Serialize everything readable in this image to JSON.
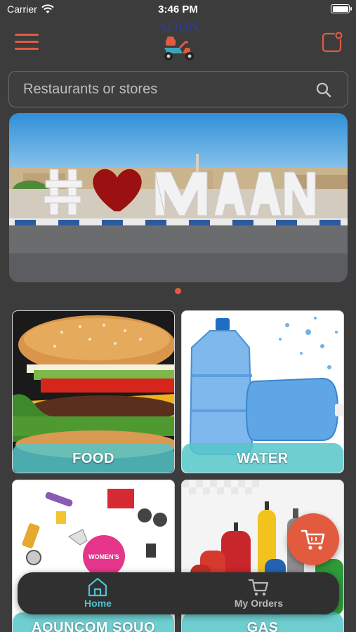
{
  "status_bar": {
    "carrier": "Carrier",
    "time": "3:46 PM"
  },
  "header": {
    "logo_text": "AOUN"
  },
  "search": {
    "placeholder": "Restaurants or stores"
  },
  "banner": {
    "slide_count": 1,
    "active_slide": 0
  },
  "categories": [
    {
      "label": "FOOD"
    },
    {
      "label": "WATER"
    },
    {
      "label": "AOUNCOM SOUQ"
    },
    {
      "label": "GAS"
    }
  ],
  "nav": {
    "home_label": "Home",
    "orders_label": "My Orders",
    "active": "Home"
  },
  "colors": {
    "accent": "#e25b3f",
    "active_tab": "#4ec3cf",
    "label_band": "#55c5c8",
    "background": "#3c3c3c"
  }
}
